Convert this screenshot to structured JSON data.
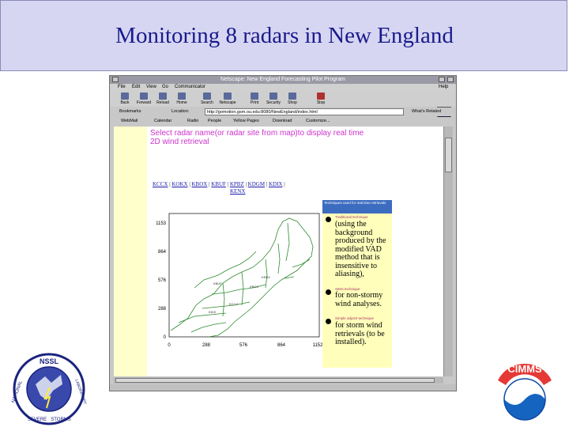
{
  "slide": {
    "title": "Monitoring 8 radars in New England"
  },
  "browser": {
    "window_title": "Netscape: New England Forecasting Pilot Program",
    "menu": [
      "File",
      "Edit",
      "View",
      "Go",
      "Communicator",
      "Help"
    ],
    "toolbar": [
      "Back",
      "Forward",
      "Reload",
      "Home",
      "Search",
      "Netscape",
      "Print",
      "Security",
      "Shop",
      "Stop"
    ],
    "bookmarks_label": "Bookmarks",
    "location_label": "Location:",
    "location_url": "http://gomotion.gsm.ou.edu:8080/NewEngland/index.html",
    "related_label": "What's Related",
    "links": [
      "WebMail",
      "Calendar",
      "Radio",
      "People",
      "Yellow Pages",
      "Download",
      "Customize..."
    ]
  },
  "page": {
    "heading": "Select radar name(or radar site from map)to display real time 2D wind retrieval",
    "radars": [
      "KCCX",
      "KOKX",
      "KBOX",
      "KBUF",
      "KPBZ",
      "KDGM",
      "KDIX",
      "KENX"
    ],
    "map_y_ticks": [
      "1153",
      "864",
      "576",
      "288",
      "0"
    ],
    "map_x_ticks": [
      "0",
      "288",
      "576",
      "864",
      "1152"
    ],
    "site_labels": [
      "KBUF",
      "KENX",
      "KBOX",
      "KCCX",
      "KDIX"
    ],
    "panel_header": "Techniques used for real time retrievals",
    "methods": [
      {
        "label": "Traditional technique",
        "desc": "(using the background produced by the modified VAD method that is insensitive to aliasing),"
      },
      {
        "label": "SIMA technique",
        "desc": "for non-stormy wind analyses."
      },
      {
        "label": "Simple adjoint technique",
        "desc": "for storm wind retrievals (to be installed)."
      }
    ]
  },
  "logos": {
    "nssl_lettering": [
      "NSSL",
      "NATIONAL",
      "SEVERE",
      "STORMS",
      "LABORATORY"
    ],
    "cimms_lettering": "CIMMS"
  }
}
